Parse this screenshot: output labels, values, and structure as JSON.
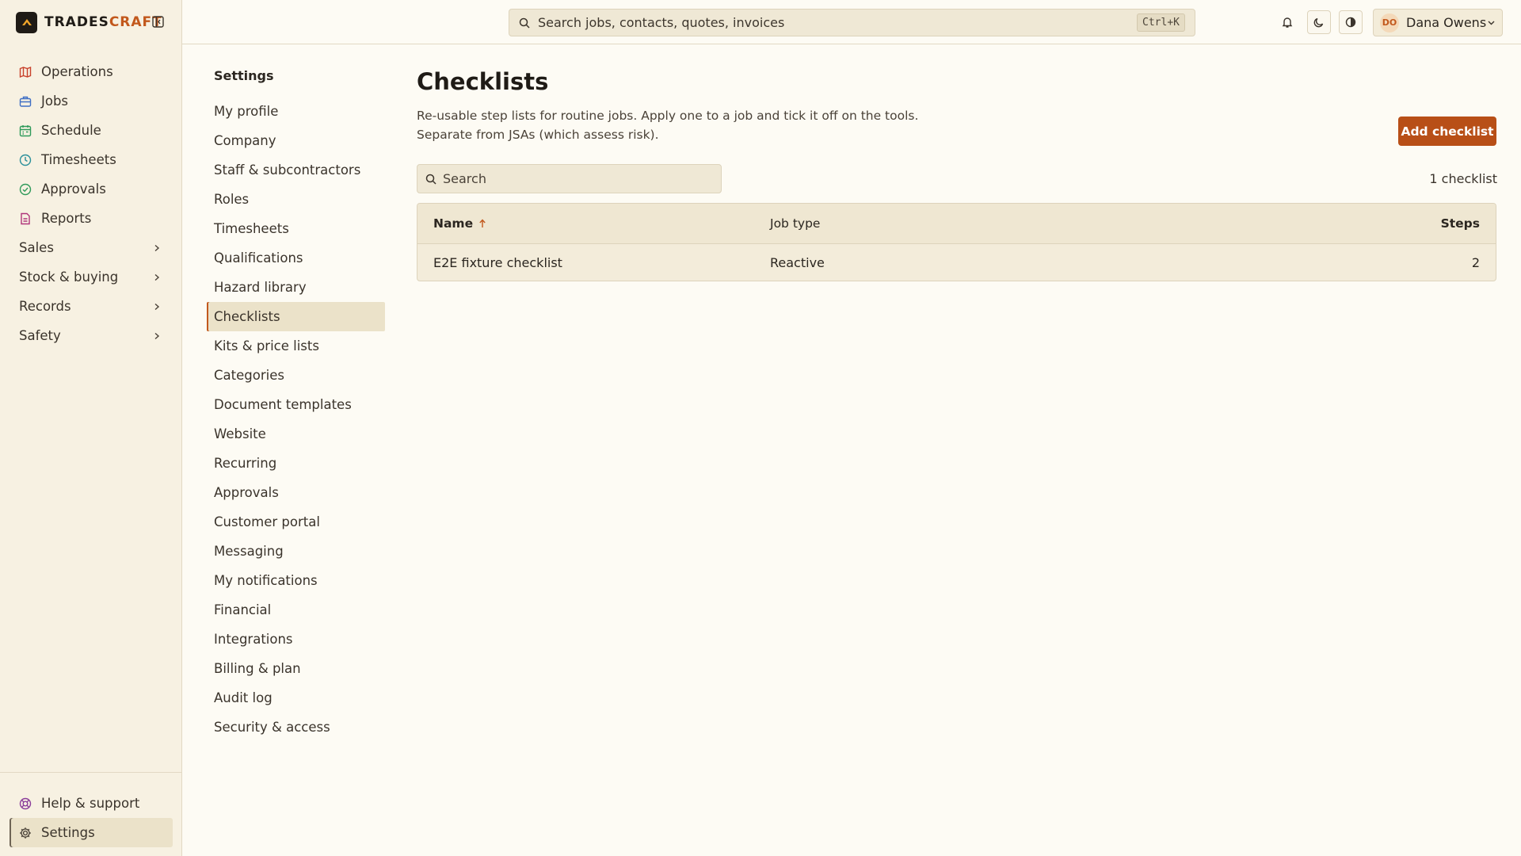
{
  "app": {
    "brand_main": "TRADES",
    "brand_accent": "CRAFT"
  },
  "sidebar": {
    "items": [
      {
        "label": "Operations",
        "icon": "map-icon",
        "color": "#c8402a"
      },
      {
        "label": "Jobs",
        "icon": "briefcase-icon",
        "color": "#3f6fc4"
      },
      {
        "label": "Schedule",
        "icon": "calendar-icon",
        "color": "#2f9a5a"
      },
      {
        "label": "Timesheets",
        "icon": "clock-icon",
        "color": "#2a8f9a"
      },
      {
        "label": "Approvals",
        "icon": "check-circle-icon",
        "color": "#2f9a5a"
      },
      {
        "label": "Reports",
        "icon": "report-icon",
        "color": "#b0357a"
      }
    ],
    "groups": [
      {
        "label": "Sales"
      },
      {
        "label": "Stock & buying"
      },
      {
        "label": "Records"
      },
      {
        "label": "Safety"
      }
    ],
    "bottom": [
      {
        "label": "Help & support",
        "icon": "lifebuoy-icon",
        "color": "#8a3d9a"
      },
      {
        "label": "Settings",
        "icon": "gear-icon",
        "color": "#4a4238"
      }
    ]
  },
  "topbar": {
    "search_placeholder": "Search jobs, contacts, quotes, invoices",
    "search_shortcut": "Ctrl+K",
    "user": {
      "initials": "DO",
      "name": "Dana Owens"
    }
  },
  "settings_nav": {
    "title": "Settings",
    "items": [
      "My profile",
      "Company",
      "Staff & subcontractors",
      "Roles",
      "Timesheets",
      "Qualifications",
      "Hazard library",
      "Checklists",
      "Kits & price lists",
      "Categories",
      "Document templates",
      "Website",
      "Recurring",
      "Approvals",
      "Customer portal",
      "Messaging",
      "My notifications",
      "Financial",
      "Integrations",
      "Billing & plan",
      "Audit log",
      "Security & access"
    ],
    "active": "Checklists"
  },
  "page": {
    "title": "Checklists",
    "description": "Re-usable step lists for routine jobs. Apply one to a job and tick it off on the tools. Separate from JSAs (which assess risk).",
    "add_button": "Add checklist",
    "search_placeholder": "Search",
    "count": "1 checklist"
  },
  "table": {
    "headers": {
      "name": "Name",
      "job_type": "Job type",
      "steps": "Steps"
    },
    "rows": [
      {
        "name": "E2E fixture checklist",
        "job_type": "Reactive",
        "steps": "2"
      }
    ]
  },
  "colors": {
    "accent": "#b84f17",
    "brand_accent": "#c2581c",
    "background": "#fdfbf4",
    "sidebar": "#f7f1e2"
  }
}
